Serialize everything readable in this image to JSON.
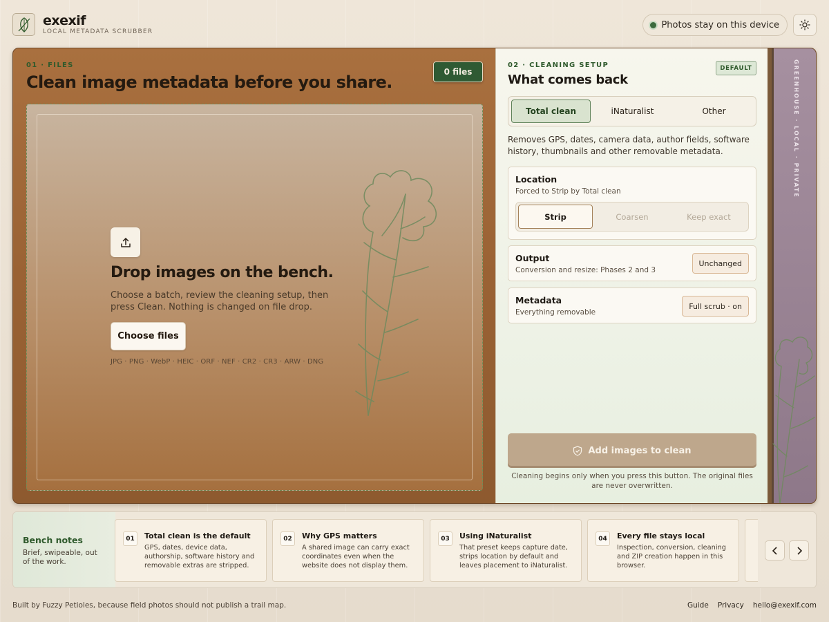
{
  "brand": {
    "name": "exexif",
    "tagline": "LOCAL METADATA SCRUBBER"
  },
  "header": {
    "privacy_label": "Photos stay on this device",
    "theme_icon": "sun-icon"
  },
  "files": {
    "section_label": "01 · FILES",
    "title": "Clean image metadata before you share.",
    "count_label": "0 files",
    "drop_heading": "Drop images on the bench.",
    "drop_desc": "Choose a batch, review the cleaning setup, then press Clean. Nothing is changed on file drop.",
    "choose_label": "Choose files",
    "formats": "JPG · PNG · WebP · HEIC · ORF · NEF · CR2 · CR3 · ARW · DNG"
  },
  "setup": {
    "section_label": "02 · CLEANING SETUP",
    "title": "What comes back",
    "badge": "DEFAULT",
    "presets": [
      "Total clean",
      "iNaturalist",
      "Other"
    ],
    "active_preset": "Total clean",
    "preset_desc": "Removes GPS, dates, camera data, author fields, software history, thumbnails and other removable metadata.",
    "location": {
      "title": "Location",
      "sub": "Forced to Strip by Total clean",
      "options": [
        "Strip",
        "Coarsen",
        "Keep exact"
      ],
      "active": "Strip"
    },
    "output": {
      "title": "Output",
      "sub": "Conversion and resize: Phases 2 and 3",
      "value": "Unchanged"
    },
    "metadata": {
      "title": "Metadata",
      "sub": "Everything removable",
      "value": "Full scrub · on"
    },
    "clean_button": "Add images to clean",
    "clean_note": "Cleaning begins only when you press this button. The original files are never overwritten."
  },
  "rail": {
    "label": "GREENHOUSE · LOCAL · PRIVATE"
  },
  "notes": {
    "title": "Bench notes",
    "sub": "Brief, swipeable, out of the work.",
    "items": [
      {
        "num": "01",
        "title": "Total clean is the default",
        "body": "GPS, dates, device data, authorship, software history and removable extras are stripped."
      },
      {
        "num": "02",
        "title": "Why GPS matters",
        "body": "A shared image can carry exact coordinates even when the website does not display them."
      },
      {
        "num": "03",
        "title": "Using iNaturalist",
        "body": "That preset keeps capture date, strips location by default and leaves placement to iNaturalist."
      },
      {
        "num": "04",
        "title": "Every file stays local",
        "body": "Inspection, conversion, cleaning and ZIP creation happen in this browser."
      }
    ]
  },
  "footer": {
    "credit": "Built by Fuzzy Petioles, because field photos should not publish a trail map.",
    "links": [
      "Guide",
      "Privacy",
      "hello@exexif.com"
    ]
  },
  "colors": {
    "accent_green": "#2f5a33",
    "bench_brown": "#9a6234",
    "rail_purple": "#9c8697"
  }
}
